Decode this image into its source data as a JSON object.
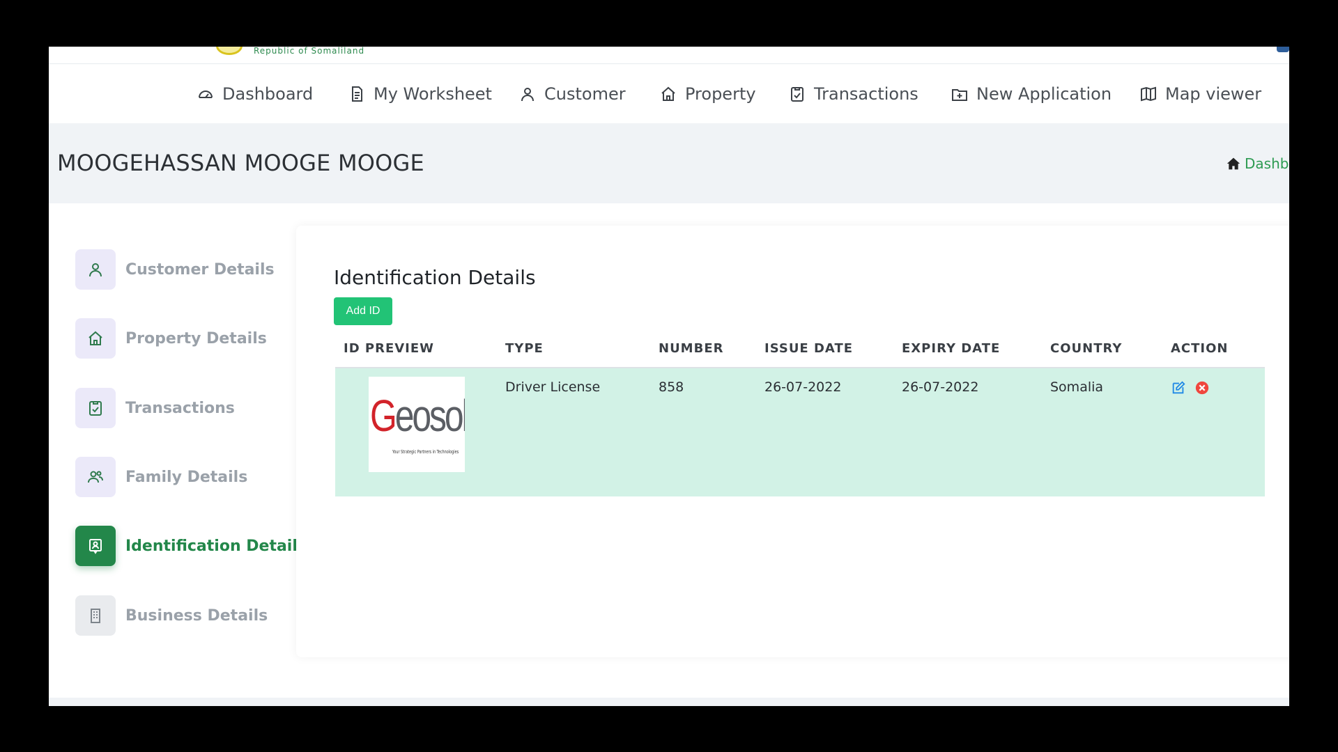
{
  "branding": {
    "subtitle": "Republic of Somaliland"
  },
  "nav": {
    "items": [
      {
        "label": "Dashboard",
        "icon": "gauge-icon"
      },
      {
        "label": "My Worksheet",
        "icon": "document-icon"
      },
      {
        "label": "Customer",
        "icon": "user-icon"
      },
      {
        "label": "Property",
        "icon": "home-icon"
      },
      {
        "label": "Transactions",
        "icon": "clipboard-check-icon"
      },
      {
        "label": "New Application",
        "icon": "folder-plus-icon"
      },
      {
        "label": "Map viewer",
        "icon": "map-icon"
      }
    ]
  },
  "header": {
    "title": "MOOGEHASSAN MOOGE MOOGE",
    "breadcrumb": "Dashboard"
  },
  "sidebar": {
    "items": [
      {
        "label": "Customer Details",
        "icon": "user-icon"
      },
      {
        "label": "Property Details",
        "icon": "home-icon"
      },
      {
        "label": "Transactions",
        "icon": "clipboard-check-icon"
      },
      {
        "label": "Family Details",
        "icon": "users-icon"
      },
      {
        "label": "Identification Details",
        "icon": "id-card-icon",
        "active": true
      },
      {
        "label": "Business Details",
        "icon": "building-icon"
      }
    ]
  },
  "card": {
    "title": "Identification Details",
    "add_button": "Add ID",
    "columns": [
      "ID PREVIEW",
      "TYPE",
      "NUMBER",
      "ISSUE DATE",
      "EXPIRY DATE",
      "COUNTRY",
      "ACTION"
    ],
    "rows": [
      {
        "preview_logo": "Geosol",
        "preview_tagline": "Your Strategic Partners in Technologies",
        "type": "Driver License",
        "number": "858",
        "issue_date": "26-07-2022",
        "expiry_date": "26-07-2022",
        "country": "Somalia"
      }
    ]
  },
  "colors": {
    "accent_green": "#22c376",
    "active_green": "#23874a",
    "row_highlight": "#d2f2e6",
    "edit_blue": "#1e88e5",
    "delete_red": "#f0473e"
  }
}
